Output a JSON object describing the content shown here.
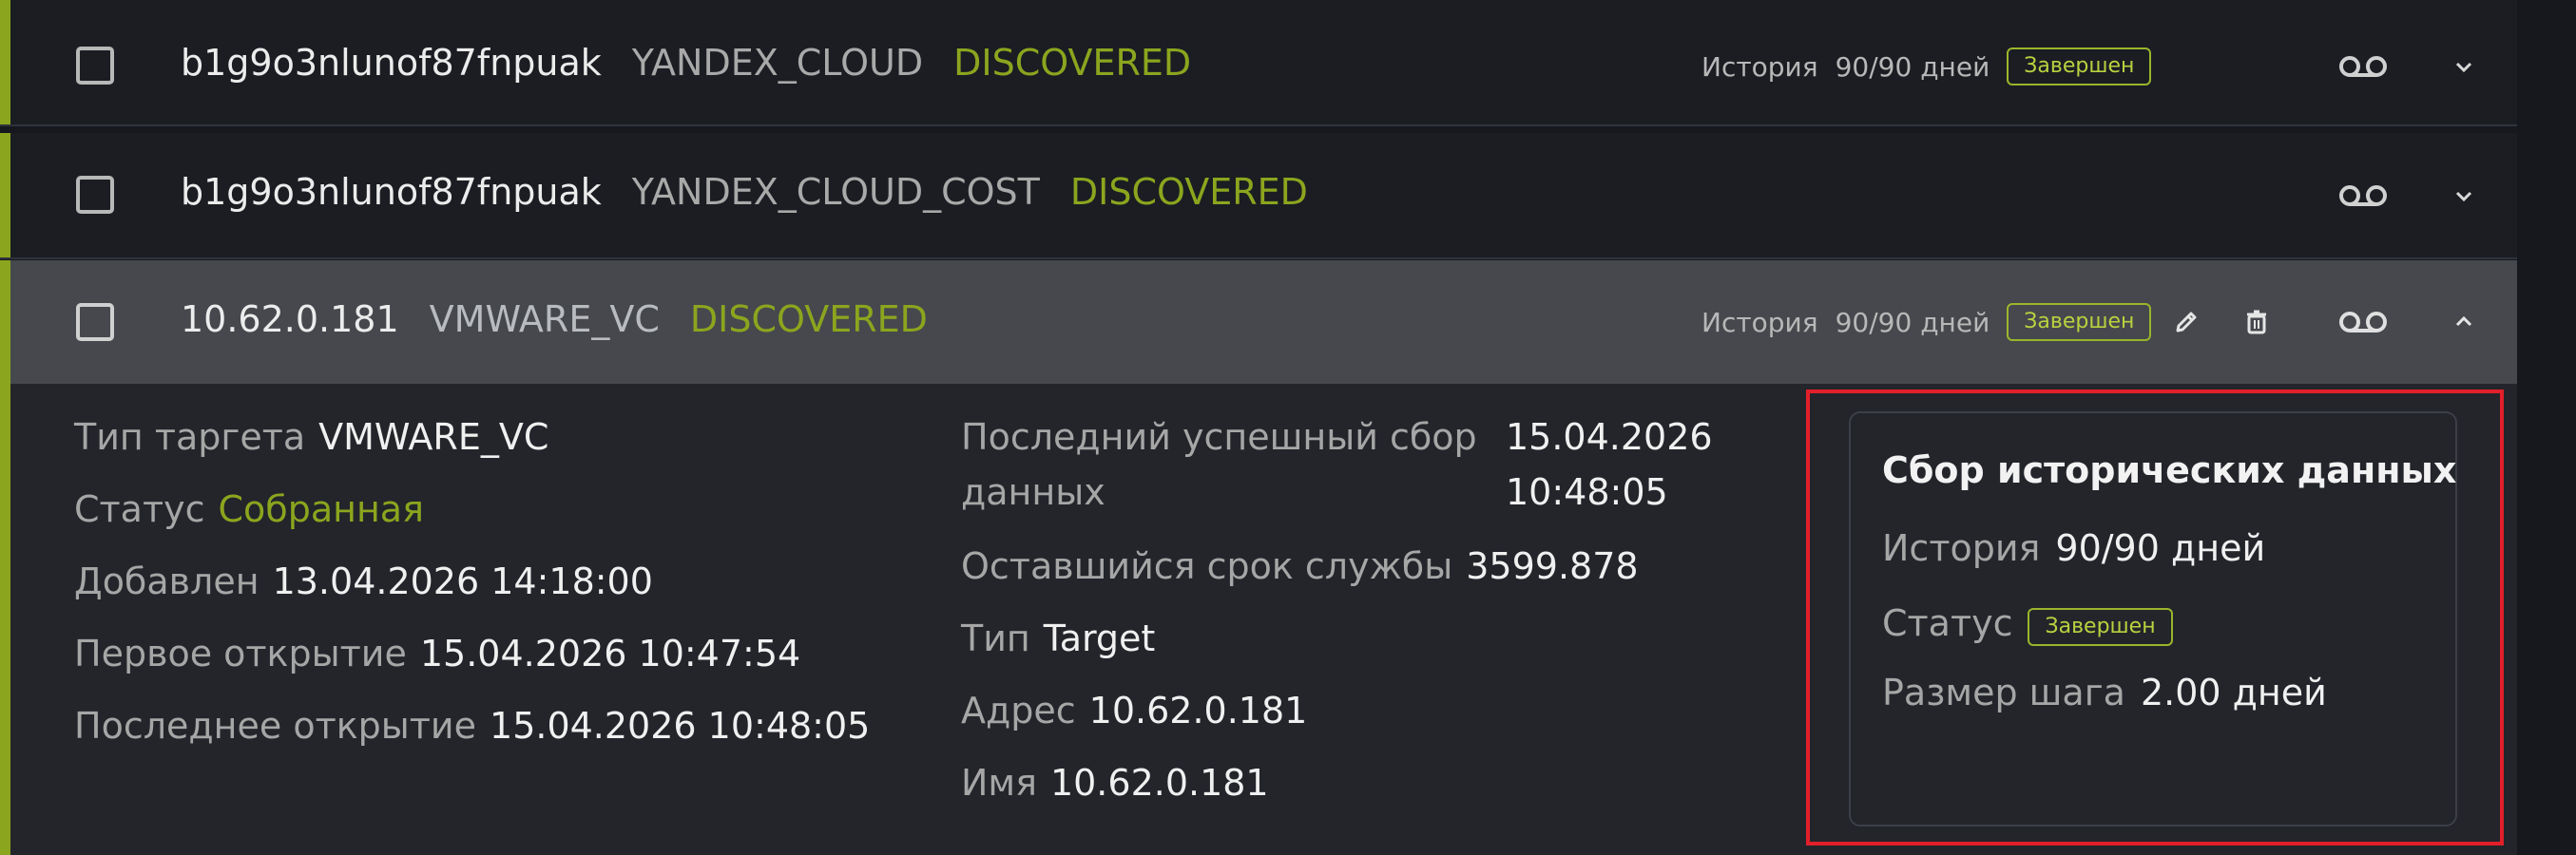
{
  "rows": [
    {
      "id": "b1g9o3nlunof87fnpuak",
      "type": "YANDEX_CLOUD",
      "state": "DISCOVERED",
      "history_label": "История",
      "history_value": "90/90 дней",
      "badge": "Завершен"
    },
    {
      "id": "b1g9o3nlunof87fnpuak",
      "type": "YANDEX_CLOUD_COST",
      "state": "DISCOVERED"
    },
    {
      "id": "10.62.0.181",
      "type": "VMWARE_VC",
      "state": "DISCOVERED",
      "history_label": "История",
      "history_value": "90/90 дней",
      "badge": "Завершен"
    }
  ],
  "details": {
    "left": [
      {
        "key": "Тип таргета",
        "value": "VMWARE_VC"
      },
      {
        "key": "Статус",
        "value": "Собранная"
      },
      {
        "key": "Добавлен",
        "value": "13.04.2026 14:18:00"
      },
      {
        "key": "Первое открытие",
        "value": "15.04.2026 10:47:54"
      },
      {
        "key": "Последнее открытие",
        "value": "15.04.2026 10:48:05"
      }
    ],
    "middle": {
      "last_collect_key_line1": "Последний успешный сбор",
      "last_collect_key_line2": "данных",
      "last_collect_value_line1": "15.04.2026",
      "last_collect_value_line2": "10:48:05",
      "items": [
        {
          "key": "Оставшийся срок службы",
          "value": "3599.878"
        },
        {
          "key": "Тип",
          "value": "Target"
        },
        {
          "key": "Адрес",
          "value": "10.62.0.181"
        },
        {
          "key": "Имя",
          "value": "10.62.0.181"
        }
      ]
    },
    "history_card": {
      "title": "Сбор исторических данных",
      "history_key": "История",
      "history_value": "90/90 дней",
      "status_key": "Статус",
      "status_badge": "Завершен",
      "step_key": "Размер шага",
      "step_value": "2.00 дней"
    }
  },
  "icons": {
    "voicemail": "voicemail-icon",
    "chevron_down": "chevron-down-icon",
    "chevron_up": "chevron-up-icon",
    "edit": "pencil-icon",
    "delete": "trash-icon"
  },
  "colors": {
    "accent": "#8ca51e",
    "highlight": "#e21f2a"
  }
}
